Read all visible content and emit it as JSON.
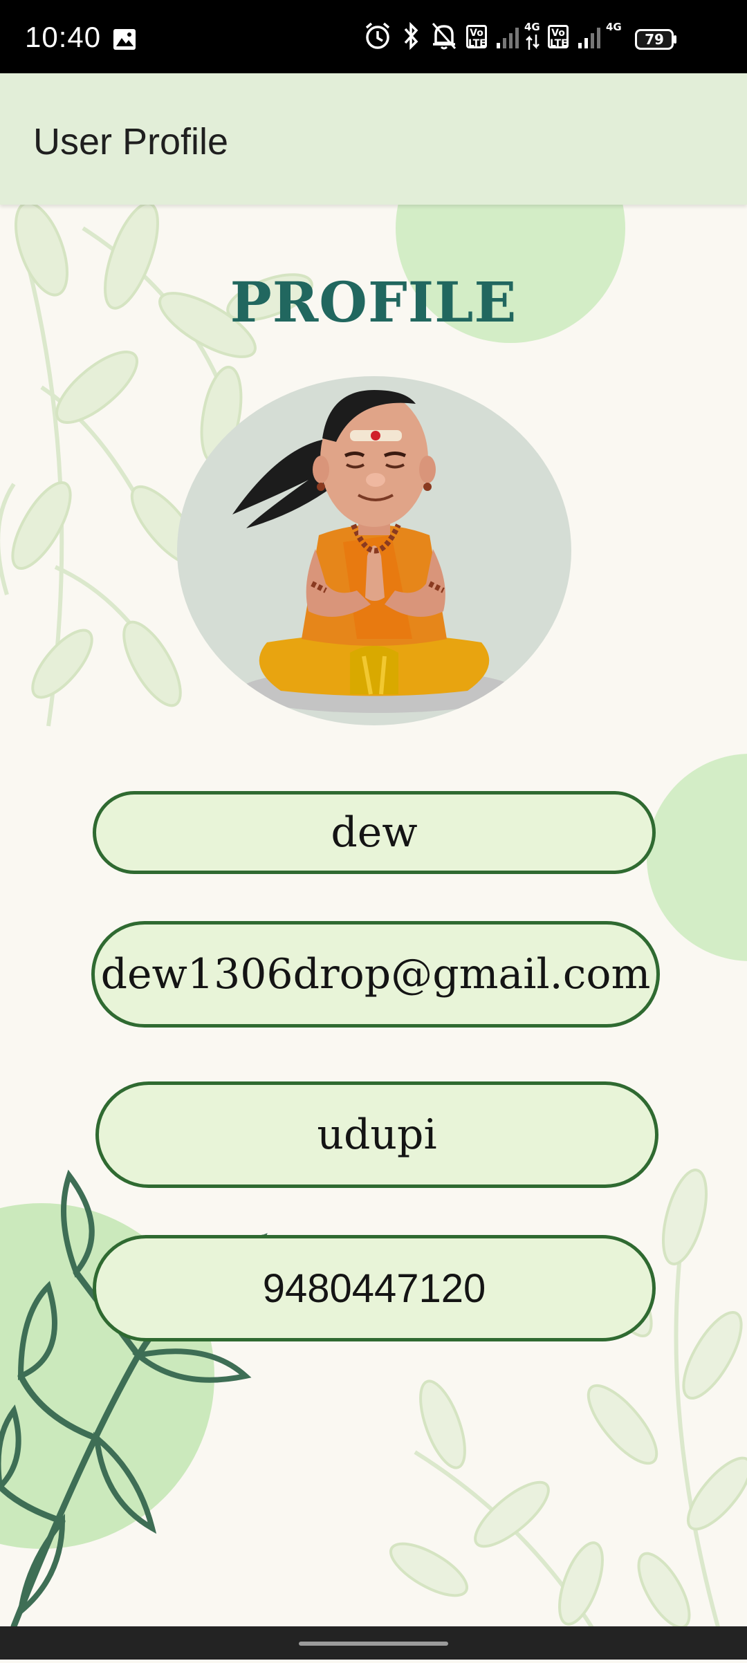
{
  "status_bar": {
    "time": "10:40",
    "network_labels": [
      "4G",
      "4G"
    ],
    "lte_label": "Vo LTE",
    "battery": "79",
    "icons": [
      "gallery-icon",
      "alarm-icon",
      "bluetooth-icon",
      "notification-bell-icon",
      "volte-icon",
      "signal-icon",
      "battery-icon"
    ]
  },
  "app_bar": {
    "title": "User Profile"
  },
  "profile": {
    "heading": "PROFILE",
    "name": "dew",
    "email": "dew1306drop@gmail.com",
    "city": "udupi",
    "phone": "9480447120"
  },
  "colors": {
    "app_bar_bg": "#e2eed8",
    "heading": "#21675f",
    "field_border": "#2f6a31",
    "field_bg": "#e8f4d8",
    "page_bg": "#faf8f2"
  }
}
